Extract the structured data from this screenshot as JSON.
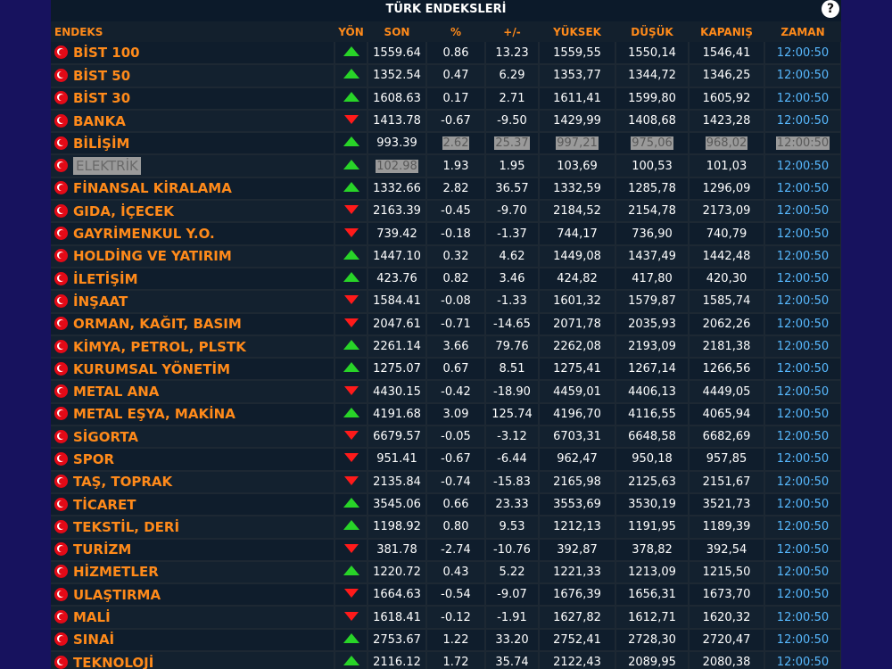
{
  "title": "TÜRK ENDEKSLERİ",
  "help_label": "?",
  "colors": {
    "up": "#28d428",
    "down": "#ff1a1a",
    "name": "#ff8a1a",
    "time": "#58b9ff"
  },
  "columns": [
    "ENDEKS",
    "YÖN",
    "SON",
    "%",
    "+/-",
    "YÜKSEK",
    "DÜŞÜK",
    "KAPANIŞ",
    "ZAMAN"
  ],
  "rows": [
    {
      "name": "BİST 100",
      "dir": "up",
      "son": "1559.64",
      "pct": "0.86",
      "chg": "13.23",
      "high": "1559,55",
      "low": "1550,14",
      "close": "1546,41",
      "time": "12:00:50"
    },
    {
      "name": "BİST 50",
      "dir": "up",
      "son": "1352.54",
      "pct": "0.47",
      "chg": "6.29",
      "high": "1353,77",
      "low": "1344,72",
      "close": "1346,25",
      "time": "12:00:50"
    },
    {
      "name": "BİST 30",
      "dir": "up",
      "son": "1608.63",
      "pct": "0.17",
      "chg": "2.71",
      "high": "1611,41",
      "low": "1599,80",
      "close": "1605,92",
      "time": "12:00:50"
    },
    {
      "name": "BANKA",
      "dir": "down",
      "son": "1413.78",
      "pct": "-0.67",
      "chg": "-9.50",
      "high": "1429,99",
      "low": "1408,68",
      "close": "1423,28",
      "time": "12:00:50"
    },
    {
      "name": "BİLİŞİM",
      "dir": "up",
      "son": "993.39",
      "pct": "2.62",
      "chg": "25.37",
      "high": "997,21",
      "low": "975,06",
      "close": "968,02",
      "time": "12:00:50",
      "highlight": [
        "pct",
        "chg",
        "high",
        "low",
        "close",
        "time"
      ]
    },
    {
      "name": "ELEKTRİK",
      "dir": "up",
      "son": "102.98",
      "pct": "1.93",
      "chg": "1.95",
      "high": "103,69",
      "low": "100,53",
      "close": "101,03",
      "time": "12:00:50",
      "highlight": [
        "name",
        "son"
      ]
    },
    {
      "name": "FİNANSAL KİRALAMA",
      "dir": "up",
      "son": "1332.66",
      "pct": "2.82",
      "chg": "36.57",
      "high": "1332,59",
      "low": "1285,78",
      "close": "1296,09",
      "time": "12:00:50"
    },
    {
      "name": "GIDA, İÇECEK",
      "dir": "down",
      "son": "2163.39",
      "pct": "-0.45",
      "chg": "-9.70",
      "high": "2184,52",
      "low": "2154,78",
      "close": "2173,09",
      "time": "12:00:50"
    },
    {
      "name": "GAYRİMENKUL Y.O.",
      "dir": "down",
      "son": "739.42",
      "pct": "-0.18",
      "chg": "-1.37",
      "high": "744,17",
      "low": "736,90",
      "close": "740,79",
      "time": "12:00:50"
    },
    {
      "name": "HOLDİNG VE YATIRIM",
      "dir": "up",
      "son": "1447.10",
      "pct": "0.32",
      "chg": "4.62",
      "high": "1449,08",
      "low": "1437,49",
      "close": "1442,48",
      "time": "12:00:50"
    },
    {
      "name": "İLETİŞİM",
      "dir": "up",
      "son": "423.76",
      "pct": "0.82",
      "chg": "3.46",
      "high": "424,82",
      "low": "417,80",
      "close": "420,30",
      "time": "12:00:50"
    },
    {
      "name": "İNŞAAT",
      "dir": "down",
      "son": "1584.41",
      "pct": "-0.08",
      "chg": "-1.33",
      "high": "1601,32",
      "low": "1579,87",
      "close": "1585,74",
      "time": "12:00:50"
    },
    {
      "name": "ORMAN, KAĞIT, BASIM",
      "dir": "down",
      "son": "2047.61",
      "pct": "-0.71",
      "chg": "-14.65",
      "high": "2071,78",
      "low": "2035,93",
      "close": "2062,26",
      "time": "12:00:50"
    },
    {
      "name": "KİMYA, PETROL, PLSTK",
      "dir": "up",
      "son": "2261.14",
      "pct": "3.66",
      "chg": "79.76",
      "high": "2262,08",
      "low": "2193,09",
      "close": "2181,38",
      "time": "12:00:50"
    },
    {
      "name": "KURUMSAL YÖNETİM",
      "dir": "up",
      "son": "1275.07",
      "pct": "0.67",
      "chg": "8.51",
      "high": "1275,41",
      "low": "1267,14",
      "close": "1266,56",
      "time": "12:00:50"
    },
    {
      "name": "METAL ANA",
      "dir": "down",
      "son": "4430.15",
      "pct": "-0.42",
      "chg": "-18.90",
      "high": "4459,01",
      "low": "4406,13",
      "close": "4449,05",
      "time": "12:00:50"
    },
    {
      "name": "METAL EŞYA, MAKİNA",
      "dir": "up",
      "son": "4191.68",
      "pct": "3.09",
      "chg": "125.74",
      "high": "4196,70",
      "low": "4116,55",
      "close": "4065,94",
      "time": "12:00:50"
    },
    {
      "name": "SİGORTA",
      "dir": "down",
      "son": "6679.57",
      "pct": "-0.05",
      "chg": "-3.12",
      "high": "6703,31",
      "low": "6648,58",
      "close": "6682,69",
      "time": "12:00:50"
    },
    {
      "name": "SPOR",
      "dir": "down",
      "son": "951.41",
      "pct": "-0.67",
      "chg": "-6.44",
      "high": "962,47",
      "low": "950,18",
      "close": "957,85",
      "time": "12:00:50"
    },
    {
      "name": "TAŞ, TOPRAK",
      "dir": "down",
      "son": "2135.84",
      "pct": "-0.74",
      "chg": "-15.83",
      "high": "2165,98",
      "low": "2125,63",
      "close": "2151,67",
      "time": "12:00:50"
    },
    {
      "name": "TİCARET",
      "dir": "up",
      "son": "3545.06",
      "pct": "0.66",
      "chg": "23.33",
      "high": "3553,69",
      "low": "3530,19",
      "close": "3521,73",
      "time": "12:00:50"
    },
    {
      "name": "TEKSTİL, DERİ",
      "dir": "up",
      "son": "1198.92",
      "pct": "0.80",
      "chg": "9.53",
      "high": "1212,13",
      "low": "1191,95",
      "close": "1189,39",
      "time": "12:00:50"
    },
    {
      "name": "TURİZM",
      "dir": "down",
      "son": "381.78",
      "pct": "-2.74",
      "chg": "-10.76",
      "high": "392,87",
      "low": "378,82",
      "close": "392,54",
      "time": "12:00:50"
    },
    {
      "name": "HİZMETLER",
      "dir": "up",
      "son": "1220.72",
      "pct": "0.43",
      "chg": "5.22",
      "high": "1221,33",
      "low": "1213,09",
      "close": "1215,50",
      "time": "12:00:50"
    },
    {
      "name": "ULAŞTIRMA",
      "dir": "down",
      "son": "1664.63",
      "pct": "-0.54",
      "chg": "-9.07",
      "high": "1676,39",
      "low": "1656,31",
      "close": "1673,70",
      "time": "12:00:50"
    },
    {
      "name": "MALİ",
      "dir": "down",
      "son": "1618.41",
      "pct": "-0.12",
      "chg": "-1.91",
      "high": "1627,82",
      "low": "1612,71",
      "close": "1620,32",
      "time": "12:00:50"
    },
    {
      "name": "SINAİ",
      "dir": "up",
      "son": "2753.67",
      "pct": "1.22",
      "chg": "33.20",
      "high": "2752,41",
      "low": "2728,30",
      "close": "2720,47",
      "time": "12:00:50"
    },
    {
      "name": "TEKNOLOJİ",
      "dir": "up",
      "son": "2116.12",
      "pct": "1.72",
      "chg": "35.74",
      "high": "2122,43",
      "low": "2089,95",
      "close": "2080,38",
      "time": "12:00:50"
    }
  ]
}
